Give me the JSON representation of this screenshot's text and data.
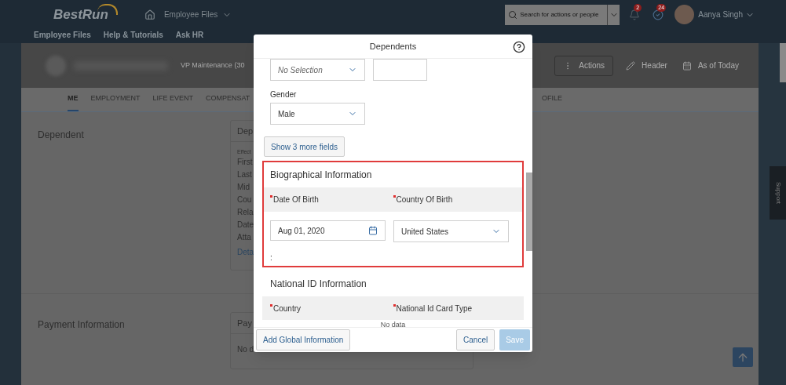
{
  "top_bar": {
    "logo": "BestRun",
    "nav": "Employee Files",
    "search": {
      "placeholder": "Search for actions or people"
    },
    "notifications": "2",
    "tasks": "24",
    "user": "Aanya Singh"
  },
  "menu": [
    "Employee Files",
    "Help & Tutorials",
    "Ask HR"
  ],
  "profile_header": {
    "title": "VP Maintenance (30",
    "actions": [
      {
        "kind": "menu",
        "label": "Actions"
      },
      {
        "kind": "edit",
        "label": "Header"
      },
      {
        "kind": "date",
        "label": "As of Today"
      }
    ]
  },
  "tabs": [
    {
      "label": "ME",
      "selected": true
    },
    {
      "label": "EMPLOYMENT",
      "selected": false
    },
    {
      "label": "LIFE EVENT",
      "selected": false
    },
    {
      "label": "COMPENSAT",
      "selected": false
    },
    {
      "label": "OFILE",
      "selected": false
    }
  ],
  "sections": [
    {
      "title": "Dependent",
      "card": {
        "title": "Dep",
        "caption": "Effect",
        "rows": [
          "First",
          "Last",
          "Mid",
          "Cou",
          "Rela",
          "Date",
          "Atta"
        ],
        "link": "Deta"
      }
    },
    {
      "title": "Payment Information",
      "card": {
        "title": "Pay",
        "rows": [
          "No d"
        ]
      }
    }
  ],
  "support_tab": "Support",
  "dialog": {
    "title": "Dependents",
    "top_fields": [
      {
        "kind": "select",
        "value": "No Selection",
        "placeholder": true
      },
      {
        "kind": "text"
      }
    ],
    "gender": {
      "label": "Gender",
      "value": "Male"
    },
    "more_button": "Show 3 more fields",
    "biographical": {
      "title": "Biographical Information",
      "highlighted": true,
      "columns": [
        {
          "label": "Date Of Birth",
          "required": true
        },
        {
          "label": "Country Of Birth",
          "required": true
        }
      ],
      "fields": [
        {
          "kind": "date",
          "value": "Aug 01, 2020"
        },
        {
          "kind": "select",
          "value": "United States"
        }
      ],
      "note": ":"
    },
    "national_id": {
      "title": "National ID Information",
      "columns": [
        {
          "label": "Country",
          "required": true
        },
        {
          "label": "National Id Card Type",
          "required": true
        }
      ],
      "empty": "No data"
    },
    "footer": {
      "add_button": "Add Global Information",
      "cancel": "Cancel",
      "save": {
        "label": "Save",
        "disabled": true
      }
    }
  }
}
